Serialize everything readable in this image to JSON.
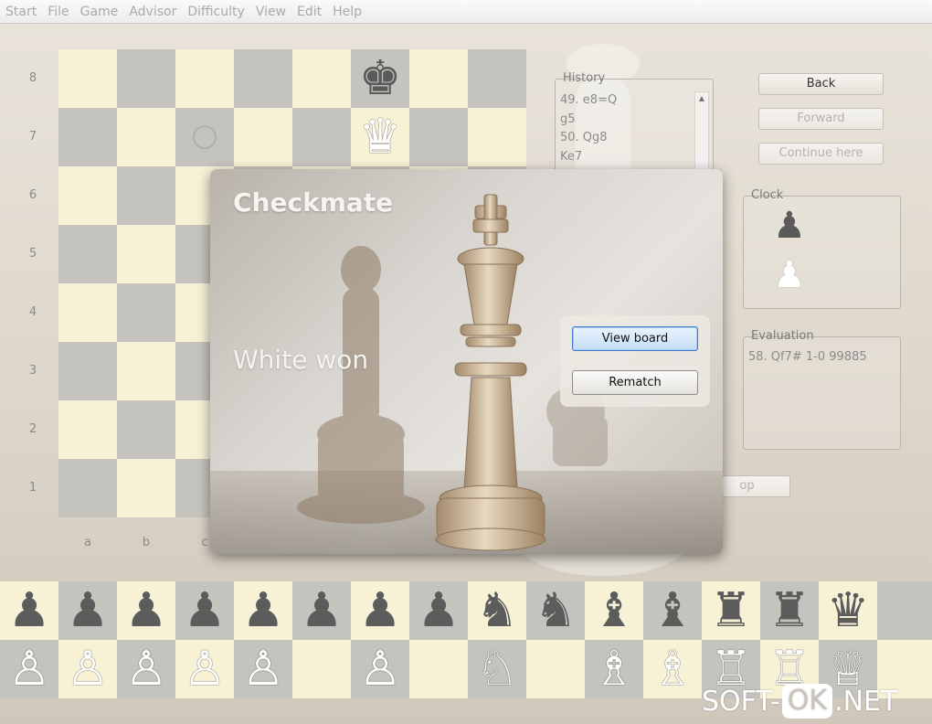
{
  "menu": [
    "Start",
    "File",
    "Game",
    "Advisor",
    "Difficulty",
    "View",
    "Edit",
    "Help"
  ],
  "board": {
    "ranks": [
      "8",
      "7",
      "6",
      "5",
      "4",
      "3",
      "2",
      "1"
    ],
    "files": [
      "a",
      "b",
      "c"
    ],
    "pieces": [
      {
        "square": "f8",
        "glyph": "♚",
        "color": "#5a5a5a",
        "name": "black-king-icon"
      },
      {
        "square": "f7",
        "glyph": "♛",
        "color": "#ffffff",
        "name": "white-queen-icon"
      }
    ],
    "marker_square": "c7"
  },
  "history": {
    "title": "History",
    "moves": [
      "49. e8=Q",
      "g5",
      "50. Qg8",
      "Ke7"
    ]
  },
  "side_buttons": {
    "back": "Back",
    "forward": "Forward",
    "continue": "Continue here",
    "stop": "op"
  },
  "clock": {
    "title": "Clock"
  },
  "evaluation": {
    "title": "Evaluation",
    "text": "58. Qf7# 1-0 99885"
  },
  "dialog": {
    "title": "Checkmate",
    "result": "White won",
    "view_board": "View board",
    "rematch": "Rematch"
  },
  "captured": {
    "row1": [
      "♟",
      "♟",
      "♟",
      "♟",
      "♟",
      "♟",
      "♟",
      "♟",
      "♞",
      "♞",
      "♝",
      "♝",
      "♜",
      "♜",
      "♛",
      ""
    ],
    "row2": [
      "♙",
      "♙",
      "♙",
      "♙",
      "♙",
      "",
      "♙",
      "",
      "♘",
      "",
      "♗",
      "♗",
      "♖",
      "♖",
      "♕",
      ""
    ]
  },
  "watermark": {
    "left": "SOFT-",
    "box": "OK",
    "right": ".NET"
  }
}
